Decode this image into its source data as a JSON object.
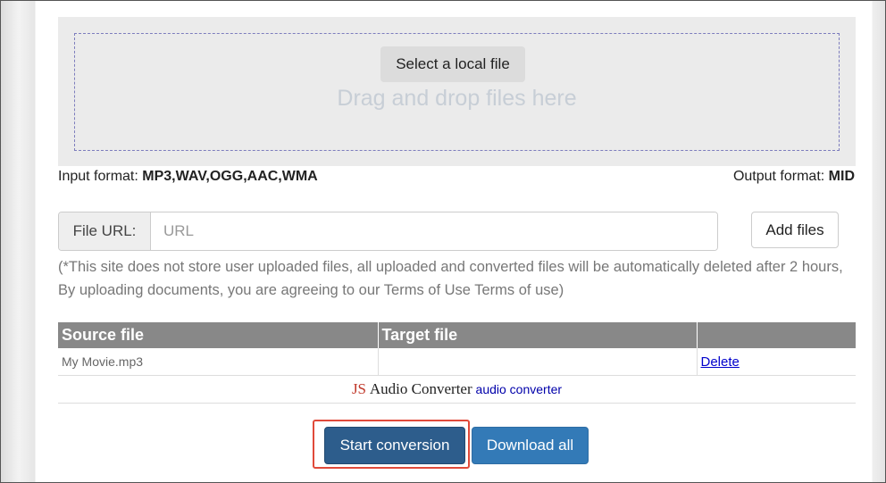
{
  "upload": {
    "select_label": "Select a local file",
    "drop_hint": "Drag and drop files here"
  },
  "formats": {
    "input_label": "Input format:",
    "input_value": "MP3,WAV,OGG,AAC,WMA",
    "output_label": "Output format:",
    "output_value": "MID"
  },
  "url": {
    "label": "File URL:",
    "placeholder": "URL",
    "value": "",
    "add_label": "Add files"
  },
  "notice": "(*This site does not store user uploaded files, all uploaded and converted files will be automatically deleted after 2 hours, By uploading documents, you are agreeing to our Terms of Use Terms of use)",
  "table": {
    "headers": [
      "Source file",
      "Target file",
      ""
    ],
    "rows": [
      {
        "source": "My Movie.mp3",
        "target": "",
        "action": "Delete"
      }
    ]
  },
  "brand": {
    "js": "JS",
    "name": "Audio Converter",
    "sub": "audio converter"
  },
  "actions": {
    "start_label": "Start conversion",
    "download_label": "Download all"
  },
  "colors": {
    "start_button": "#2d5d8c",
    "download_button": "#337ab7",
    "highlight": "#e04a3a",
    "table_header": "#888888"
  }
}
